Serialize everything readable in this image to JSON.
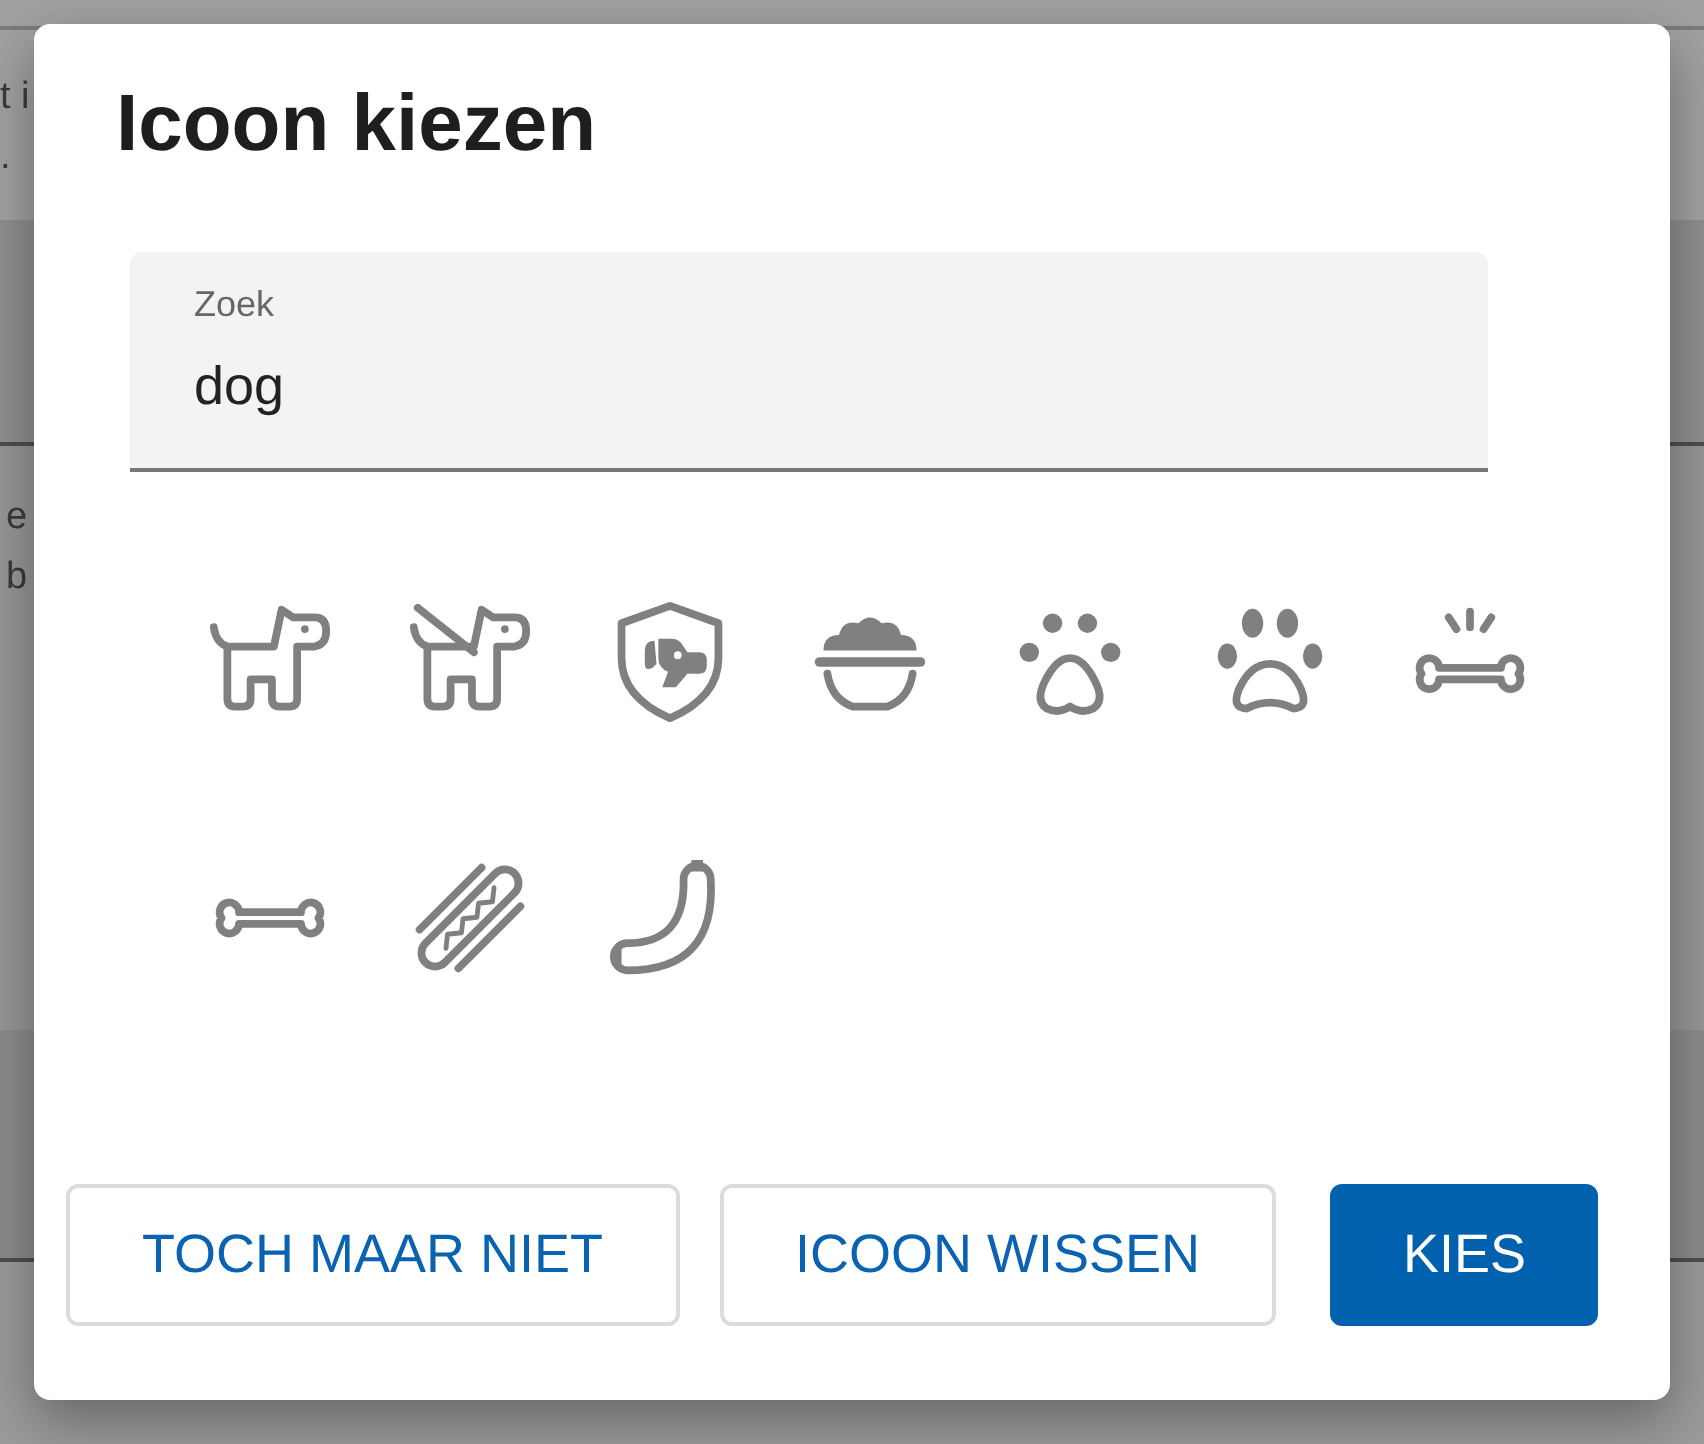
{
  "page_behind": {
    "sections": [
      {
        "lines": [
          "t i",
          "."
        ]
      },
      {
        "lines": [
          "e",
          "b"
        ]
      }
    ]
  },
  "dialog": {
    "title": "Icoon kiezen",
    "search": {
      "label": "Zoek",
      "value": "dog"
    },
    "results": [
      {
        "kind": "dog"
      },
      {
        "kind": "leashdog"
      },
      {
        "kind": "shield"
      },
      {
        "kind": "bowl"
      },
      {
        "kind": "paw"
      },
      {
        "kind": "pawprint"
      },
      {
        "kind": "snap"
      },
      {
        "kind": "bone"
      },
      {
        "kind": "hotdog"
      },
      {
        "kind": "sausage"
      }
    ],
    "buttons": [
      {
        "label": "TOCH MAAR NIET",
        "kind": "outlined"
      },
      {
        "label": "ICOON WISSEN",
        "kind": "outlined"
      },
      {
        "label": "KIES",
        "kind": "filled"
      }
    ]
  }
}
